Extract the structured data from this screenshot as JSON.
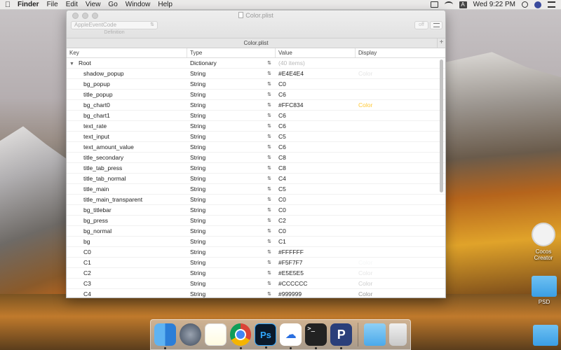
{
  "menubar": {
    "apple": "",
    "items": [
      "Finder",
      "File",
      "Edit",
      "View",
      "Go",
      "Window",
      "Help"
    ],
    "input_source": "A",
    "clock": "Wed 9:22 PM"
  },
  "window": {
    "title": "Color.plist",
    "popup_value": "AppleEventCode",
    "popup_caption": "Definition",
    "tb_button1": "off",
    "tab_label": "Color.plist",
    "tab_plus": "+"
  },
  "columns": {
    "key": "Key",
    "type": "Type",
    "value": "Value",
    "display": "Display"
  },
  "rows": [
    {
      "key": "Root",
      "type": "Dictionary",
      "value": "(40 items)",
      "display": ""
    },
    {
      "key": "shadow_popup",
      "type": "String",
      "value": "#E4E4E4",
      "display": "Color"
    },
    {
      "key": "bg_popup",
      "type": "String",
      "value": "C0",
      "display": ""
    },
    {
      "key": "title_popup",
      "type": "String",
      "value": "C6",
      "display": ""
    },
    {
      "key": "bg_chart0",
      "type": "String",
      "value": "#FFC834",
      "display": "Color"
    },
    {
      "key": "bg_chart1",
      "type": "String",
      "value": "C6",
      "display": ""
    },
    {
      "key": "text_rate",
      "type": "String",
      "value": "C6",
      "display": ""
    },
    {
      "key": "text_input",
      "type": "String",
      "value": "C5",
      "display": ""
    },
    {
      "key": "text_amount_value",
      "type": "String",
      "value": "C6",
      "display": ""
    },
    {
      "key": "title_secondary",
      "type": "String",
      "value": "C8",
      "display": ""
    },
    {
      "key": "title_tab_press",
      "type": "String",
      "value": "C8",
      "display": ""
    },
    {
      "key": "title_tab_normal",
      "type": "String",
      "value": "C4",
      "display": ""
    },
    {
      "key": "title_main",
      "type": "String",
      "value": "C5",
      "display": ""
    },
    {
      "key": "title_main_transparent",
      "type": "String",
      "value": "C0",
      "display": ""
    },
    {
      "key": "bg_titlebar",
      "type": "String",
      "value": "C0",
      "display": ""
    },
    {
      "key": "bg_press",
      "type": "String",
      "value": "C2",
      "display": ""
    },
    {
      "key": "bg_normal",
      "type": "String",
      "value": "C0",
      "display": ""
    },
    {
      "key": "bg",
      "type": "String",
      "value": "C1",
      "display": ""
    },
    {
      "key": "C0",
      "type": "String",
      "value": "#FFFFFF",
      "display": ""
    },
    {
      "key": "C1",
      "type": "String",
      "value": "#F5F7F7",
      "display": "Color"
    },
    {
      "key": "C2",
      "type": "String",
      "value": "#E5E5E5",
      "display": "Color"
    },
    {
      "key": "C3",
      "type": "String",
      "value": "#CCCCCC",
      "display": "Color"
    },
    {
      "key": "C4",
      "type": "String",
      "value": "#999999",
      "display": "Color"
    }
  ],
  "display_colors": {
    "shadow_popup": "#E4E4E4",
    "bg_chart0": "#FFC834",
    "C1": "#F5F7F7",
    "C2": "#E5E5E5",
    "C3": "#CCCCCC",
    "C4": "#999999"
  },
  "desktop": {
    "icons": [
      "Cocos Creator",
      "PSD"
    ]
  },
  "dock": {
    "apps": [
      "finder-icon",
      "launchpad-icon",
      "notes-icon",
      "chrome-icon",
      "photoshop-icon",
      "baidu-netdisk-icon",
      "terminal-icon",
      "p-app-icon"
    ],
    "ps_label": "Ps",
    "p_label": "P",
    "term_label": ">_"
  }
}
